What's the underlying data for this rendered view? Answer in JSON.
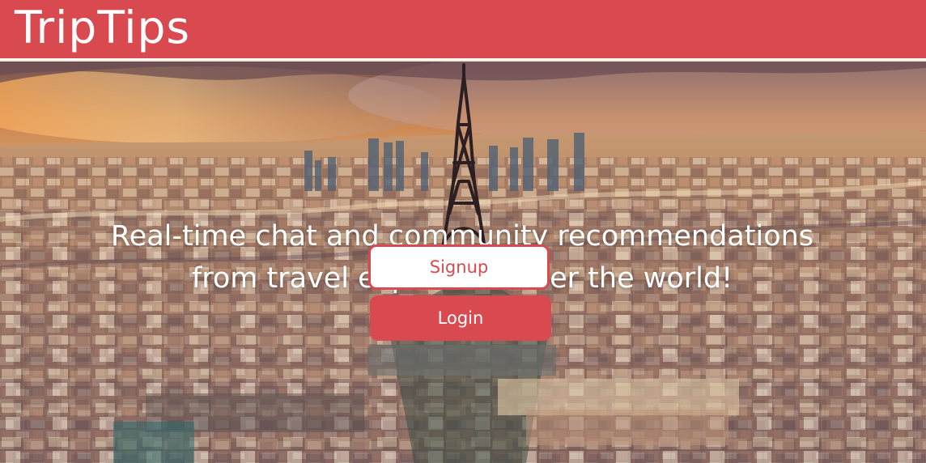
{
  "app": {
    "brand": "TripTips"
  },
  "hero": {
    "headline": "Real-time chat and community recommendations from travel experts all over the world!",
    "background": "Eiffel Tower and Paris cityscape at sunset"
  },
  "actions": {
    "signup_label": "Signup",
    "login_label": "Login"
  },
  "colors": {
    "brand_red": "#d84a4f",
    "white": "#ffffff"
  }
}
